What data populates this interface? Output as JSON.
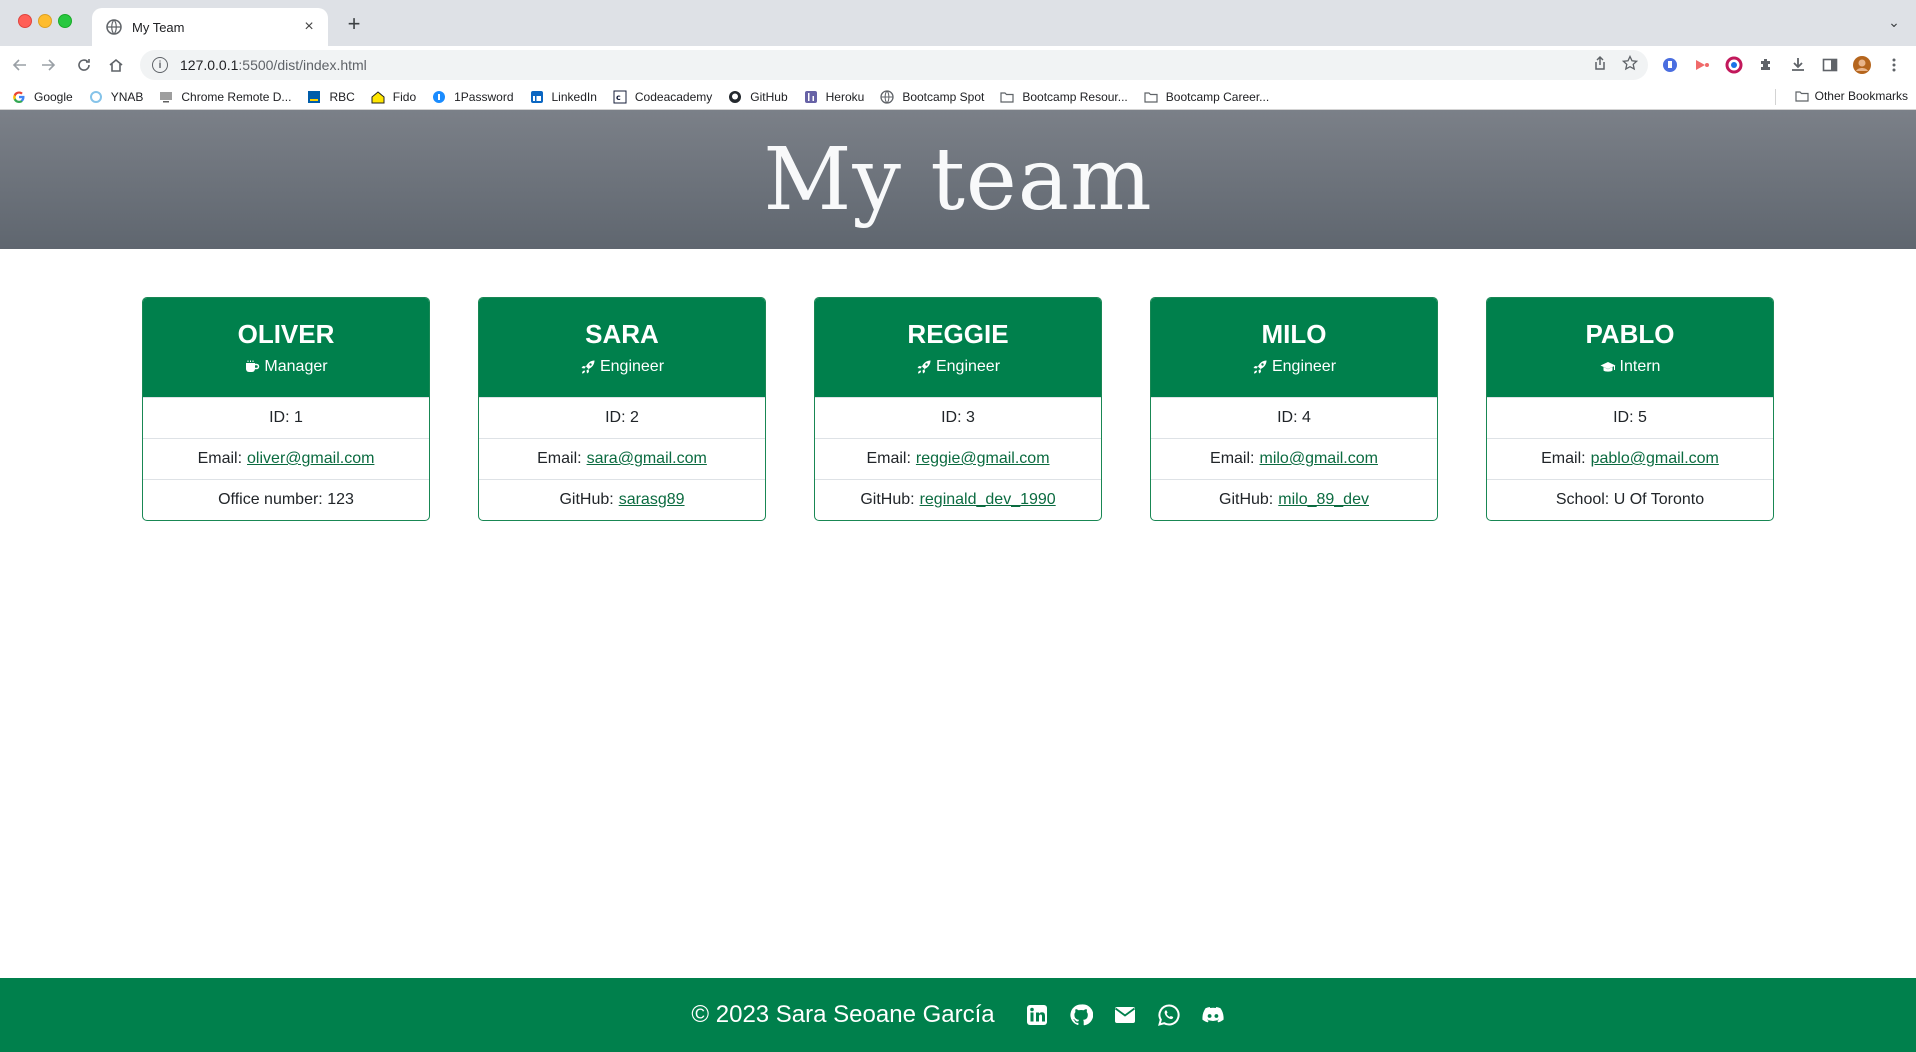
{
  "browser": {
    "tab_title": "My Team",
    "url_host": "127.0.0.1",
    "url_path": ":5500/dist/index.html",
    "bookmarks": [
      {
        "label": "Google",
        "icon": "google-icon"
      },
      {
        "label": "YNAB",
        "icon": "ynab-icon"
      },
      {
        "label": "Chrome Remote D...",
        "icon": "remote-desktop-icon"
      },
      {
        "label": "RBC",
        "icon": "rbc-icon"
      },
      {
        "label": "Fido",
        "icon": "fido-icon"
      },
      {
        "label": "1Password",
        "icon": "1password-icon"
      },
      {
        "label": "LinkedIn",
        "icon": "linkedin-icon"
      },
      {
        "label": "Codeacademy",
        "icon": "codecademy-icon"
      },
      {
        "label": "GitHub",
        "icon": "github-icon"
      },
      {
        "label": "Heroku",
        "icon": "heroku-icon"
      },
      {
        "label": "Bootcamp Spot",
        "icon": "globe-icon"
      },
      {
        "label": "Bootcamp Resour...",
        "icon": "folder-icon"
      },
      {
        "label": "Bootcamp Career...",
        "icon": "folder-icon"
      }
    ],
    "other_bookmarks": "Other Bookmarks"
  },
  "page": {
    "title": "My team",
    "accent_color": "#00804c",
    "hero_color": "#6c727b"
  },
  "team": [
    {
      "name": "OLIVER",
      "role": "Manager",
      "role_icon": "mug-icon",
      "id_label": "ID: 1",
      "email_label": "Email:",
      "email": "oliver@gmail.com",
      "extra_label": "Office number: 123",
      "extra_link": ""
    },
    {
      "name": "SARA",
      "role": "Engineer",
      "role_icon": "rocket-icon",
      "id_label": "ID: 2",
      "email_label": "Email:",
      "email": "sara@gmail.com",
      "extra_label": "GitHub:",
      "extra_link": "sarasg89"
    },
    {
      "name": "REGGIE",
      "role": "Engineer",
      "role_icon": "rocket-icon",
      "id_label": "ID: 3",
      "email_label": "Email:",
      "email": "reggie@gmail.com",
      "extra_label": "GitHub:",
      "extra_link": "reginald_dev_1990"
    },
    {
      "name": "MILO",
      "role": "Engineer",
      "role_icon": "rocket-icon",
      "id_label": "ID: 4",
      "email_label": "Email:",
      "email": "milo@gmail.com",
      "extra_label": "GitHub:",
      "extra_link": "milo_89_dev"
    },
    {
      "name": "PABLO",
      "role": "Intern",
      "role_icon": "graduation-cap-icon",
      "id_label": "ID: 5",
      "email_label": "Email:",
      "email": "pablo@gmail.com",
      "extra_label": "School: U Of Toronto",
      "extra_link": ""
    }
  ],
  "footer": {
    "text": "© 2023 Sara Seoane García",
    "social_icons": [
      "linkedin-icon",
      "github-icon",
      "envelope-icon",
      "whatsapp-icon",
      "discord-icon"
    ]
  }
}
